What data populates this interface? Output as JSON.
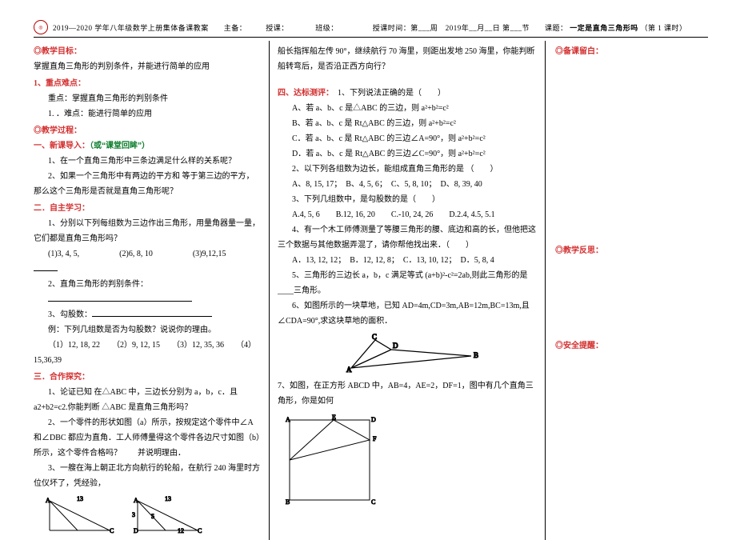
{
  "header": {
    "line": "2019—2020 学年八年级数学上册集体备课教案　　主备：　　　授课：　　　　班级：　　　　　授课时间：第___周　2019年__月__日 第___节　　课题：",
    "topic": "一定是直角三角形吗",
    "suffix": "（第 1 课时）"
  },
  "col1": {
    "goalTitle": "◎教学目标：",
    "goalText": "掌握直角三角形的判别条件，并能进行简单的应用",
    "kpTitle": "1、重点难点：",
    "kp1": "重点：掌握直角三角形的判别条件",
    "kp2": "1. ．难点：能进行简单的应用",
    "procTitle": "◎教学过程：",
    "leadTitle": "一、新课导入：",
    "leadAlt": "（或“课堂回眸”）",
    "lead1": "1、在一个直角三角形中三条边满足什么样的关系呢？",
    "lead2": "2、如果一个三角形中有两边的平方和 等于第三边的平方，那么这个三角形是否就是直角三角形呢？",
    "selfTitle": "二．自主学习：",
    "self1": "1、分别以下列每组数为三边作出三角形，用量角器量一量，它们都是直角三角形吗？",
    "self1a": "(1)3, 4, 5,　　　　　(2)6, 8, 10　　　　　(3)9,12,15　　　",
    "self2": "2、直角三角形的判别条件：",
    "self3": "3、勾股数：",
    "ex": "例：下列几组数是否为勾股数？说说你的理由。",
    "exline": "（1）12, 18, 22　　（2）9, 12, 15　　（3）12, 35, 36　　（4）15,36,39",
    "coopTitle": "三．合作探究：",
    "coop1": "1、论证已知 在△ABC 中，三边长分别为 a，b，c．且 a2+b2=c2.你能判断 △ABC 是直角三角形吗？",
    "coop2": "2、一个零件的形状如图（a）所示，按规定这个零件中∠A 和∠DBC 都应为直角．工人师傅量得这个零件各边尺寸如图（b）所示，这个零件合格吗？　　并说明理由．",
    "coop3": "3、一艘在海上朝正北方向航行的轮船，在航行 240 海里时方位仪坏了，凭经验，"
  },
  "col2": {
    "topText": "船长指挥船左传 90°，继续航行 70 海里，则距出发地 250 海里，你能判断船转弯后，是否沿正西方向行？",
    "testTitle": "四、达标测评：",
    "q1": "1、下列说法正确的是（　　）",
    "q1a": "A、若 a、b、c 是△ABC 的三边，则 a²+b²=c²",
    "q1b": "B、若 a、b、c 是 Rt△ABC 的三边，则 a²+b²=c²",
    "q1c": "C．若 a、b、c 是 Rt△ABC 的三边∠A=90°，则 a²+b²=c²",
    "q1d": "D．若 a、b、c 是 Rt△ABC 的三边∠C=90°，则 a²+b²=c²",
    "q2": "2、以下列各组数为边长，能组成直角三角形的是 （　　）",
    "q2opts": "A、8, 15, 17；　B、4, 5, 6；　C、5, 8, 10；　D、8, 39, 40",
    "q3": "3、下列几组数中，是勾股数的是（　　）",
    "q3opts": "A.4, 5, 6　　B.12, 16, 20　　C.-10, 24, 26　　D.2.4, 4.5, 5.1",
    "q4": "4、有一个木工师傅测量了等腰三角形的腰、底边和高的长，但他把这三个数据与其他数据弄混了，请你帮他找出来．（　　）",
    "q4opts": "A．13, 12, 12；　B．12, 12, 8；　C．13, 10, 12；　D．5, 8, 4",
    "q5": "5、三角形的三边长 a，b，c 满足等式 (a+b)²-c²=2ab,则此三角形的是____三角形。",
    "q6": "6、如图所示的一块草地，已知 AD=4m,CD=3m,AB=12m,BC=13m,且　∠CDA=90°,求这块草地的面积．",
    "q7": "7、如图，在正方形 ABCD 中，AB=4，AE=2，DF=1，图中有几个直角三角形，你是如何"
  },
  "col3": {
    "note1": "◎备课留白：",
    "note2": "◎教学反思：",
    "note3": "◎安全提醒："
  }
}
